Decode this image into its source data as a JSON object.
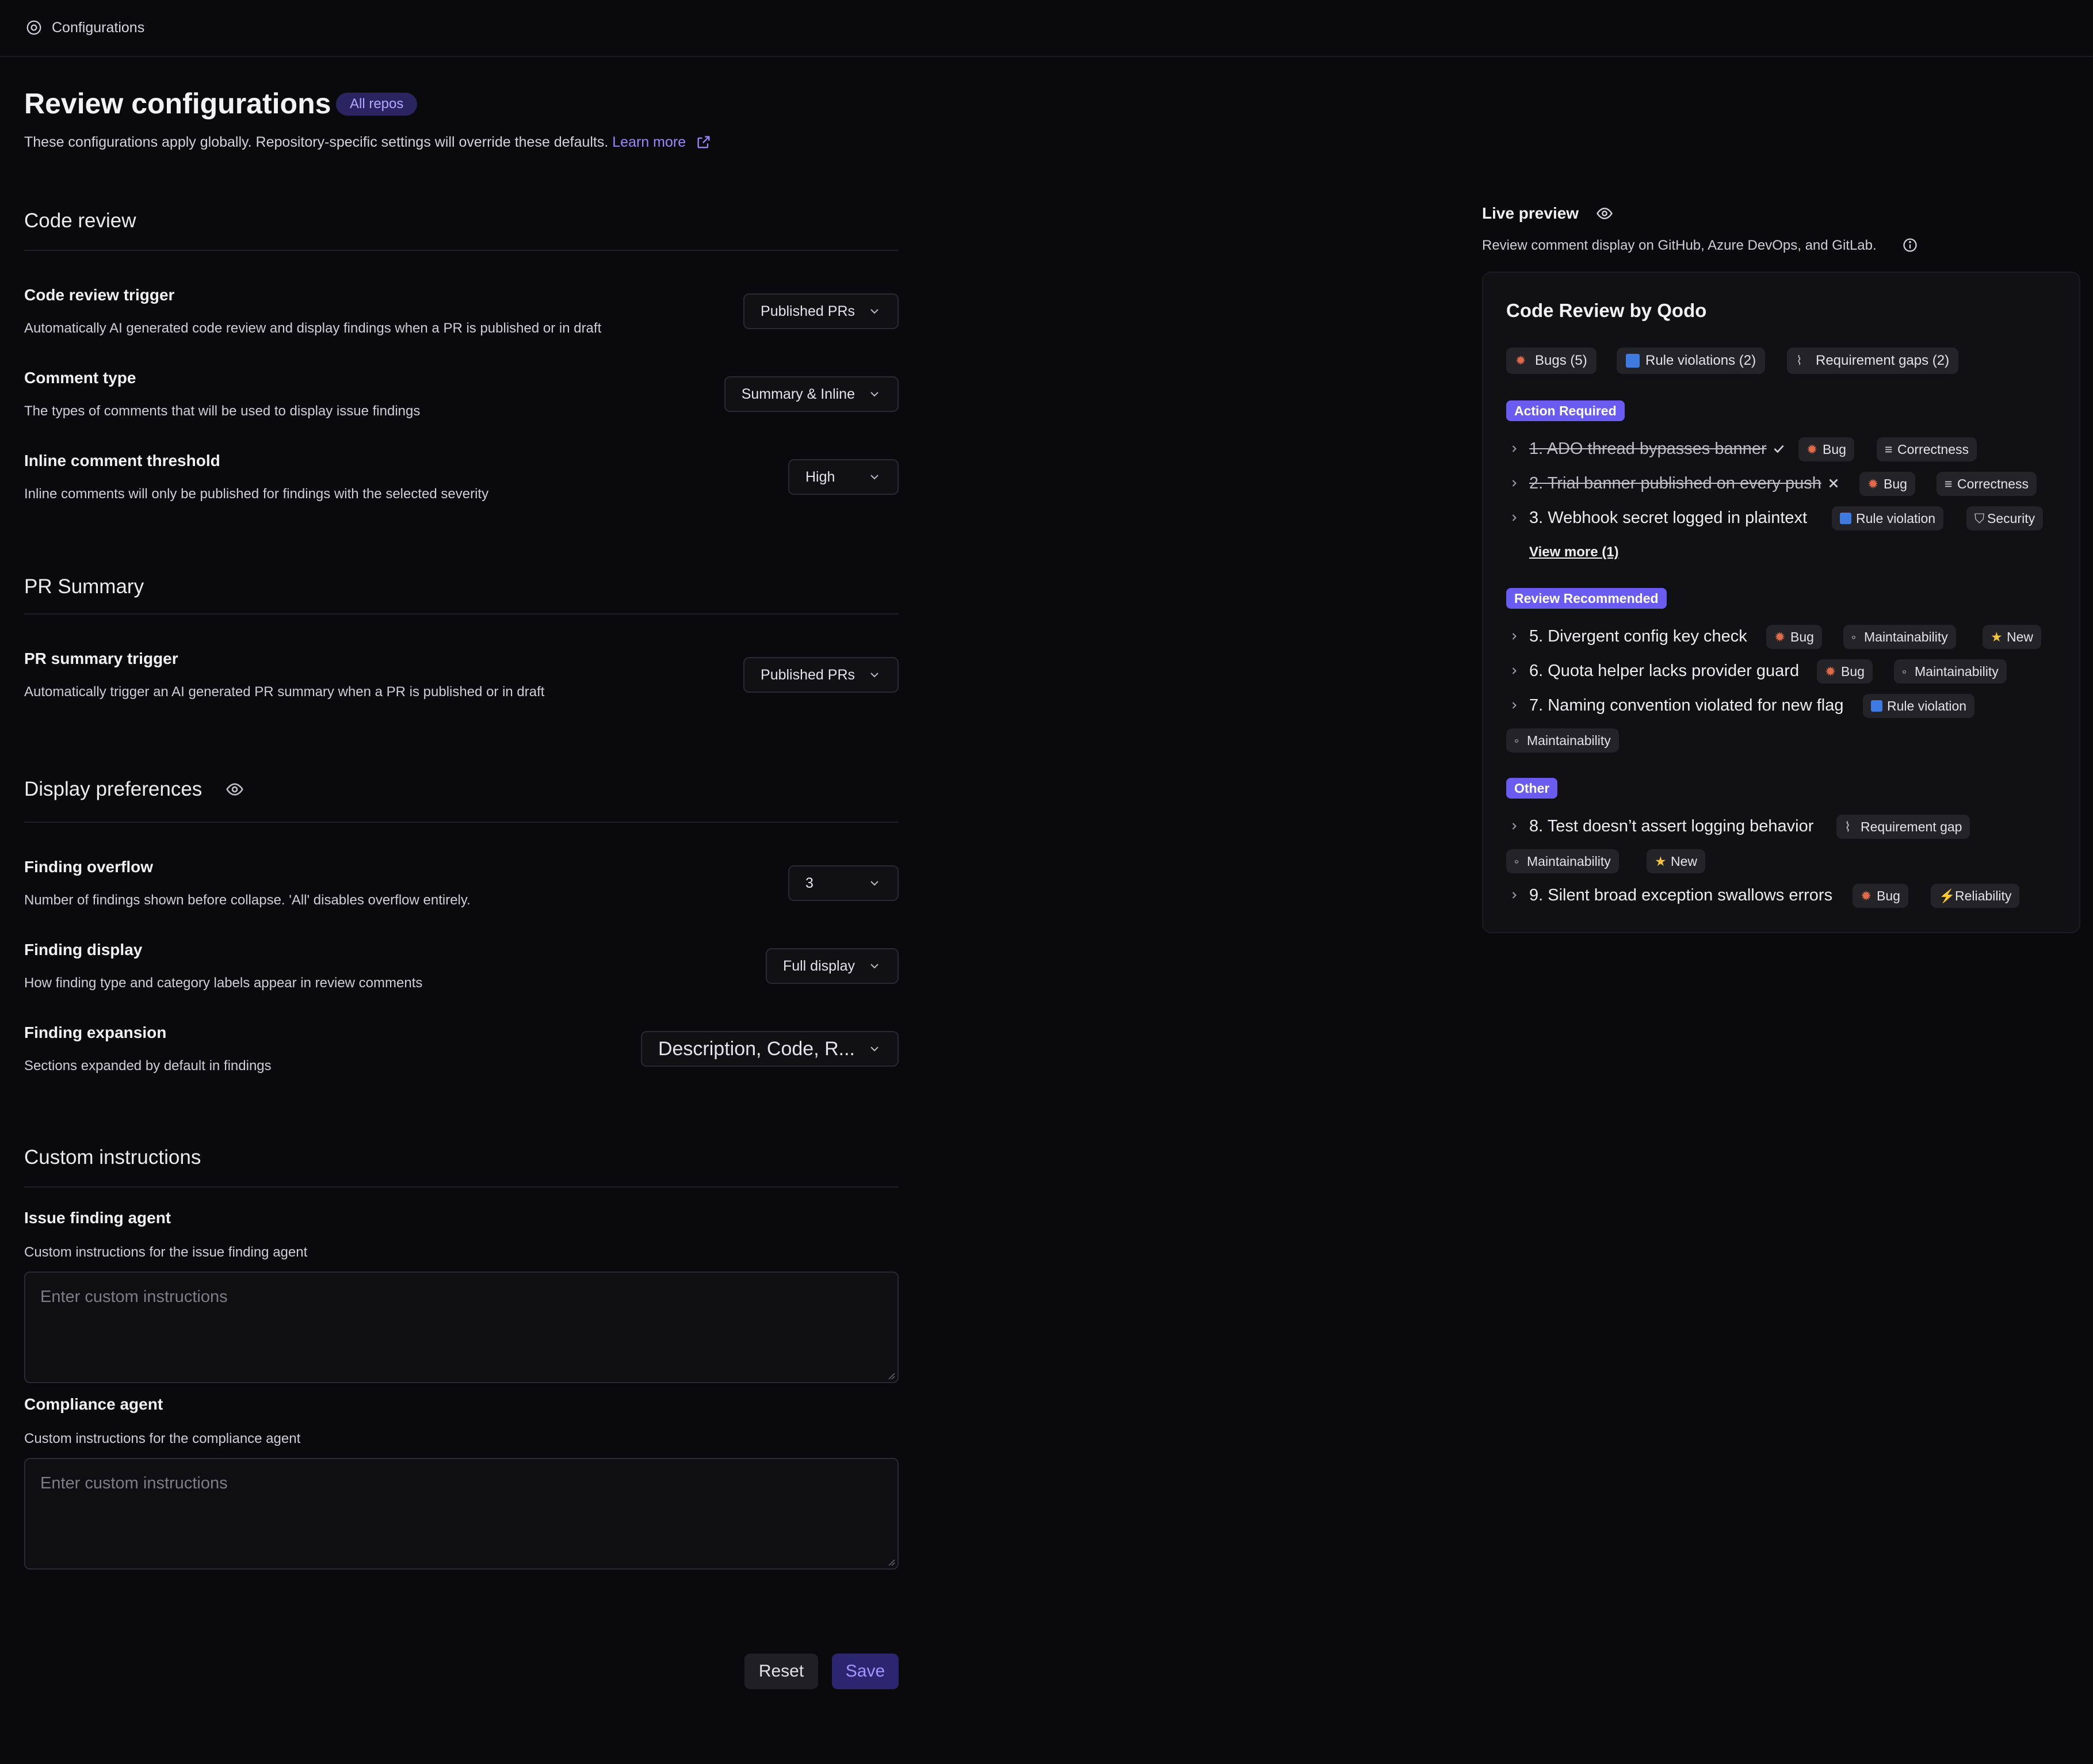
{
  "topbar": {
    "breadcrumb": "Configurations",
    "icon": "gear-icon"
  },
  "header": {
    "title": "Review configurations",
    "badge": "All repos",
    "subtitle": "These configurations apply globally. Repository-specific settings will override these defaults.",
    "learn_more": "Learn more"
  },
  "sections": {
    "code_review": {
      "title": "Code review",
      "trigger": {
        "label": "Code review trigger",
        "desc": "Automatically AI generated code review and display findings when a PR is published or in draft",
        "value": "Published PRs"
      },
      "comment_type": {
        "label": "Comment type",
        "desc": "The types of comments that will be used to display issue findings",
        "value": "Summary & Inline"
      },
      "threshold": {
        "label": "Inline comment threshold",
        "desc": "Inline comments will only be published for findings with the selected severity",
        "value": "High"
      }
    },
    "pr_summary": {
      "title": "PR Summary",
      "trigger": {
        "label": "PR summary trigger",
        "desc": "Automatically trigger an AI generated PR summary when a PR is published or in draft",
        "value": "Published PRs"
      }
    },
    "display": {
      "title": "Display preferences",
      "overflow": {
        "label": "Finding overflow",
        "desc": "Number of findings shown before collapse. 'All' disables overflow entirely.",
        "value": "3"
      },
      "finding_display": {
        "label": "Finding display",
        "desc": "How finding type and category labels appear in review comments",
        "value": "Full display"
      },
      "expansion": {
        "label": "Finding expansion",
        "desc": "Sections expanded by default in findings",
        "value": "Description, Code, R..."
      }
    },
    "custom": {
      "title": "Custom instructions",
      "issue_agent": {
        "label": "Issue finding agent",
        "desc": "Custom instructions for the issue finding agent",
        "placeholder": "Enter custom instructions"
      },
      "compliance_agent": {
        "label": "Compliance agent",
        "desc": "Custom instructions for the compliance agent",
        "placeholder": "Enter custom instructions"
      }
    }
  },
  "actions": {
    "reset": "Reset",
    "save": "Save"
  },
  "preview": {
    "title": "Live preview",
    "subtitle": "Review comment display on GitHub, Azure DevOps, and GitLab.",
    "card_title": "Code Review by Qodo",
    "summary_chips": [
      "Bugs (5)",
      "Rule violations (2)",
      "Requirement gaps (2)"
    ],
    "groups": {
      "action_required": "Action Required",
      "review_recommended": "Review Recommended",
      "other": "Other"
    },
    "items": [
      {
        "text": "1. ADO thread bypasses banner",
        "tags": [
          "Bug",
          "Correctness"
        ]
      },
      {
        "text": "2. Trial banner published on every push",
        "tags": [
          "Bug",
          "Correctness"
        ]
      },
      {
        "text": "3. Webhook secret logged in plaintext",
        "tags": [
          "Rule violation",
          "Security"
        ]
      },
      {
        "text": "5. Divergent config key check",
        "tags": [
          "Bug",
          "Maintainability",
          "New"
        ]
      },
      {
        "text": "6. Quota helper lacks provider guard",
        "tags": [
          "Bug",
          "Maintainability"
        ]
      },
      {
        "text": "7. Naming convention violated for new flag",
        "tags": [
          "Rule violation",
          "Maintainability"
        ]
      },
      {
        "text": "8. Test doesn’t assert logging behavior",
        "tags": [
          "Requirement gap",
          "Maintainability",
          "New"
        ]
      },
      {
        "text": "9. Silent broad exception swallows errors",
        "tags": [
          "Bug",
          "Reliability"
        ]
      }
    ],
    "view_more": "View more (1)"
  },
  "colors": {
    "accent": "#6a5cf0",
    "background": "#0a0a0c",
    "link": "#9a86ff"
  }
}
